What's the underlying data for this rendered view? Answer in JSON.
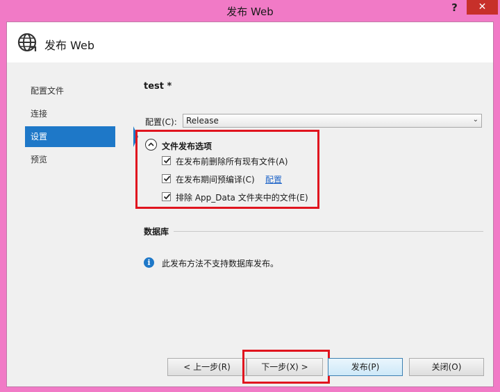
{
  "window": {
    "title": "发布 Web",
    "help_glyph": "?",
    "close_glyph": "✕"
  },
  "header": {
    "title": "发布 Web",
    "icon": "globe-icon"
  },
  "nav": {
    "items": [
      {
        "label": "配置文件",
        "selected": false
      },
      {
        "label": "连接",
        "selected": false
      },
      {
        "label": "设置",
        "selected": true
      },
      {
        "label": "预览",
        "selected": false
      }
    ]
  },
  "settings": {
    "profile_name": "test *",
    "config_label": "配置(C):",
    "config_value": "Release",
    "file_options": {
      "title": "文件发布选项",
      "options": [
        {
          "label": "在发布前删除所有现有文件(A)",
          "checked": true
        },
        {
          "label": "在发布期间预编译(C)",
          "checked": true,
          "link": "配置"
        },
        {
          "label": "排除 App_Data 文件夹中的文件(E)",
          "checked": true
        }
      ]
    },
    "database": {
      "label": "数据库",
      "info": "此发布方法不支持数据库发布。"
    }
  },
  "buttons": {
    "prev": "< 上一步(R)",
    "next": "下一步(X) >",
    "publish": "发布(P)",
    "close": "关闭(O)"
  },
  "colors": {
    "accent": "#1e78c8",
    "highlight_box": "#e0141e",
    "window_border": "#f17ac6"
  }
}
